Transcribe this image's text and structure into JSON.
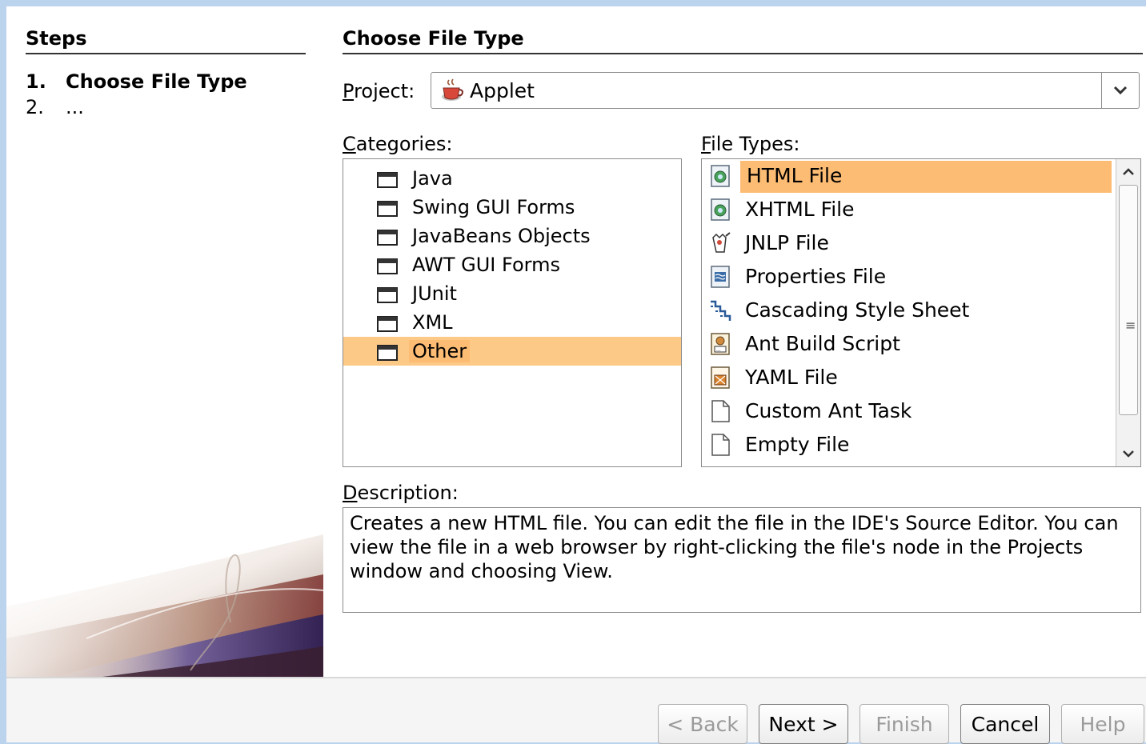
{
  "steps": {
    "title": "Steps",
    "items": [
      {
        "num": "1.",
        "label": "Choose File Type"
      },
      {
        "num": "2.",
        "label": "..."
      }
    ]
  },
  "page": {
    "title": "Choose File Type"
  },
  "project": {
    "label_prefix": "P",
    "label_rest": "roject:",
    "value": "Applet"
  },
  "categories": {
    "label_prefix": "C",
    "label_rest": "ategories:",
    "items": [
      "Java",
      "Swing GUI Forms",
      "JavaBeans Objects",
      "AWT GUI Forms",
      "JUnit",
      "XML",
      "Other"
    ],
    "selected": "Other"
  },
  "file_types": {
    "label_prefix": "F",
    "label_rest": "ile Types:",
    "items": [
      {
        "label": "HTML File",
        "icon": "html-file-icon"
      },
      {
        "label": "XHTML File",
        "icon": "xhtml-file-icon"
      },
      {
        "label": "JNLP File",
        "icon": "jnlp-file-icon"
      },
      {
        "label": "Properties File",
        "icon": "properties-file-icon"
      },
      {
        "label": "Cascading Style Sheet",
        "icon": "css-file-icon"
      },
      {
        "label": "Ant Build Script",
        "icon": "ant-build-icon"
      },
      {
        "label": "YAML File",
        "icon": "yaml-file-icon"
      },
      {
        "label": "Custom Ant Task",
        "icon": "blank-file-icon"
      },
      {
        "label": "Empty File",
        "icon": "blank-file-icon"
      }
    ],
    "selected": "HTML File"
  },
  "description": {
    "label_prefix": "D",
    "label_rest": "escription:",
    "text": "Creates a new HTML file. You can edit the file in the IDE's Source Editor. You can view the file in a web browser by right-clicking the file's node in the Projects window and choosing View."
  },
  "buttons": {
    "back": "< Back",
    "next": "Next >",
    "finish": "Finish",
    "cancel": "Cancel",
    "help": "Help"
  },
  "colors": {
    "selection": "#fdbc74",
    "background_frame": "#bcd3ee"
  }
}
